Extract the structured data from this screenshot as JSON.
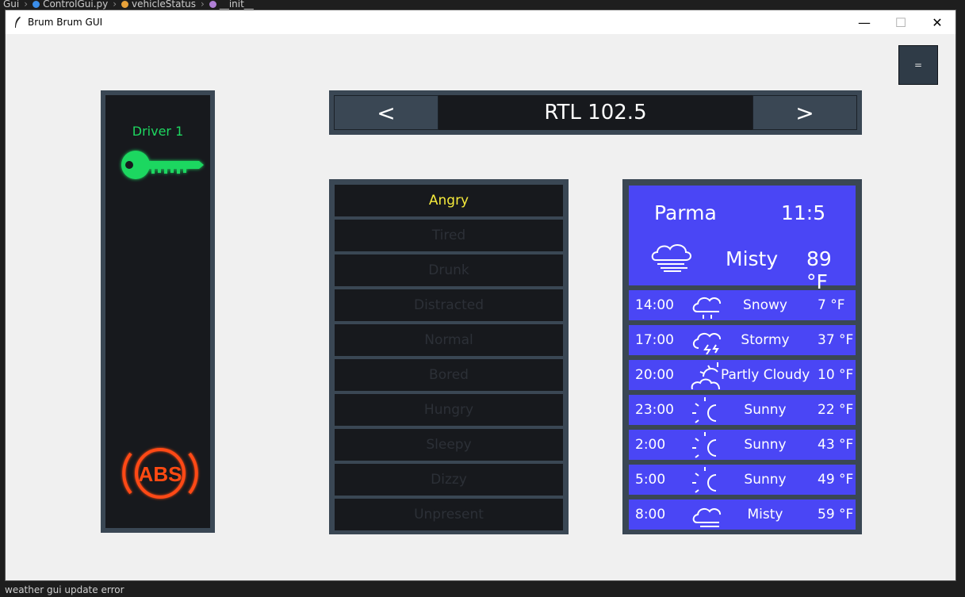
{
  "editor": {
    "breadcrumb": [
      "Gui",
      "ControlGui.py",
      "vehicleStatus",
      "__init__"
    ],
    "status_line": "weather gui update error"
  },
  "window": {
    "title": "Brum Brum GUI",
    "minimize": "—",
    "maximize": "☐",
    "close": "✕"
  },
  "menu_button": {
    "label": "="
  },
  "driver": {
    "label": "Driver 1",
    "abs_label": "ABS",
    "key_color": "#1ed760",
    "abs_color": "#ff4a12"
  },
  "radio": {
    "prev": "<",
    "station": "RTL 102.5",
    "next": ">"
  },
  "moods": [
    {
      "label": "Angry",
      "active": true
    },
    {
      "label": "Tired",
      "active": false
    },
    {
      "label": "Drunk",
      "active": false
    },
    {
      "label": "Distracted",
      "active": false
    },
    {
      "label": "Normal",
      "active": false
    },
    {
      "label": "Bored",
      "active": false
    },
    {
      "label": "Hungry",
      "active": false
    },
    {
      "label": "Sleepy",
      "active": false
    },
    {
      "label": "Dizzy",
      "active": false
    },
    {
      "label": "Unpresent",
      "active": false
    }
  ],
  "weather": {
    "current": {
      "city": "Parma",
      "time": "11:5",
      "condition": "Misty",
      "temp": "89 °F",
      "icon": "fog-icon"
    },
    "forecast": [
      {
        "time": "14:00",
        "condition": "Snowy",
        "temp": "7 °F",
        "icon": "snow-icon"
      },
      {
        "time": "17:00",
        "condition": "Stormy",
        "temp": "37 °F",
        "icon": "storm-icon"
      },
      {
        "time": "20:00",
        "condition": "Partly Cloudy",
        "temp": "10 °F",
        "icon": "partly-cloudy-icon"
      },
      {
        "time": "23:00",
        "condition": "Sunny",
        "temp": "22 °F",
        "icon": "sun-icon"
      },
      {
        "time": "2:00",
        "condition": "Sunny",
        "temp": "43 °F",
        "icon": "sun-icon"
      },
      {
        "time": "5:00",
        "condition": "Sunny",
        "temp": "49 °F",
        "icon": "sun-icon"
      },
      {
        "time": "8:00",
        "condition": "Misty",
        "temp": "59 °F",
        "icon": "fog-icon"
      }
    ]
  },
  "colors": {
    "panel_frame": "#3a4754",
    "panel_dark": "#17191d",
    "weather_blue": "#4a46f5",
    "mood_active": "#f5ea3b",
    "mood_inactive": "#2c3037"
  }
}
